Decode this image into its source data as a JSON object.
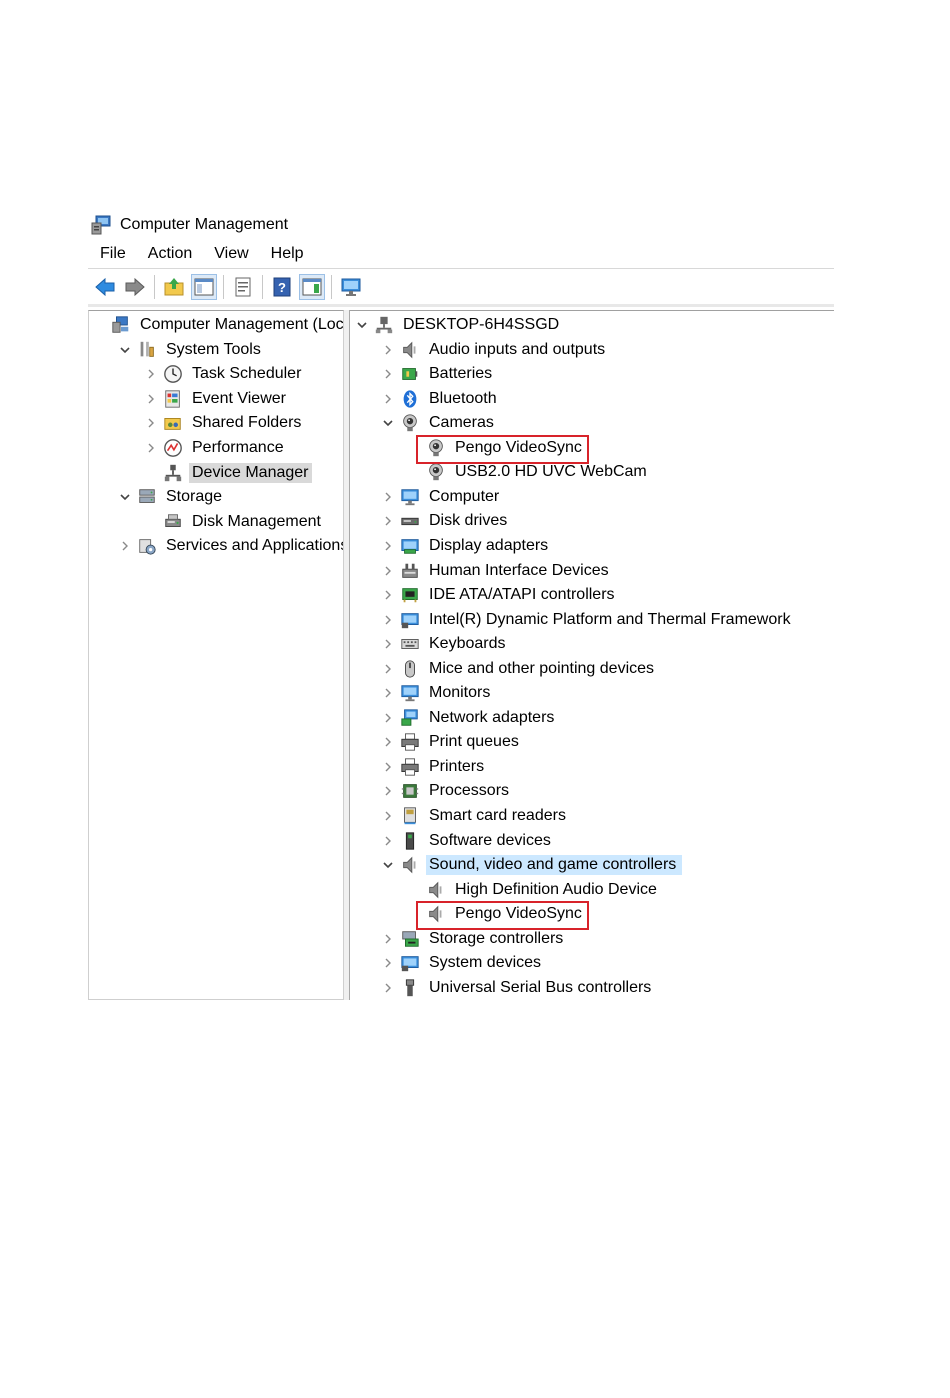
{
  "window": {
    "title": "Computer Management"
  },
  "menu": [
    "File",
    "Action",
    "View",
    "Help"
  ],
  "toolbar": [
    {
      "icon": "back-arrow-icon"
    },
    {
      "icon": "forward-arrow-icon"
    },
    {
      "sep": true
    },
    {
      "icon": "up-folder-icon"
    },
    {
      "icon": "show-hide-console-tree-icon",
      "pressed": true
    },
    {
      "sep": true
    },
    {
      "icon": "properties-icon"
    },
    {
      "sep": true
    },
    {
      "icon": "help-icon"
    },
    {
      "icon": "show-hide-action-pane-icon",
      "pressed": true
    },
    {
      "sep": true
    },
    {
      "icon": "monitor-icon"
    }
  ],
  "left_tree": [
    {
      "label": "Computer Management (Local",
      "icon": "computer-management-icon",
      "level": 0,
      "chev": "none"
    },
    {
      "label": "System Tools",
      "icon": "system-tools-icon",
      "level": 1,
      "chev": "down"
    },
    {
      "label": "Task Scheduler",
      "icon": "clock-icon",
      "level": 2,
      "chev": "right"
    },
    {
      "label": "Event Viewer",
      "icon": "event-viewer-icon",
      "level": 2,
      "chev": "right"
    },
    {
      "label": "Shared Folders",
      "icon": "shared-folders-icon",
      "level": 2,
      "chev": "right"
    },
    {
      "label": "Performance",
      "icon": "performance-icon",
      "level": 2,
      "chev": "right"
    },
    {
      "label": "Device Manager",
      "icon": "device-manager-icon",
      "level": 2,
      "chev": "none",
      "selected": true
    },
    {
      "label": "Storage",
      "icon": "storage-icon",
      "level": 1,
      "chev": "down"
    },
    {
      "label": "Disk Management",
      "icon": "disk-management-icon",
      "level": 2,
      "chev": "none"
    },
    {
      "label": "Services and Applications",
      "icon": "services-icon",
      "level": 1,
      "chev": "right"
    }
  ],
  "right_tree": [
    {
      "label": "DESKTOP-6H4SSGD",
      "icon": "computer-root-icon",
      "level": 0,
      "chev": "down"
    },
    {
      "label": "Audio inputs and outputs",
      "icon": "speaker-icon",
      "level": 1,
      "chev": "right"
    },
    {
      "label": "Batteries",
      "icon": "battery-icon",
      "level": 1,
      "chev": "right"
    },
    {
      "label": "Bluetooth",
      "icon": "bluetooth-icon",
      "level": 1,
      "chev": "right"
    },
    {
      "label": "Cameras",
      "icon": "webcam-icon",
      "level": 1,
      "chev": "down"
    },
    {
      "label": "Pengo VideoSync",
      "icon": "webcam-icon",
      "level": 2,
      "chev": "none",
      "highlight": true
    },
    {
      "label": "USB2.0 HD UVC WebCam",
      "icon": "webcam-icon",
      "level": 2,
      "chev": "none"
    },
    {
      "label": "Computer",
      "icon": "monitor-icon",
      "level": 1,
      "chev": "right"
    },
    {
      "label": "Disk drives",
      "icon": "disk-drive-icon",
      "level": 1,
      "chev": "right"
    },
    {
      "label": "Display adapters",
      "icon": "display-adapter-icon",
      "level": 1,
      "chev": "right"
    },
    {
      "label": "Human Interface Devices",
      "icon": "hid-icon",
      "level": 1,
      "chev": "right"
    },
    {
      "label": "IDE ATA/ATAPI controllers",
      "icon": "ide-controller-icon",
      "level": 1,
      "chev": "right"
    },
    {
      "label": "Intel(R) Dynamic Platform and Thermal Framework",
      "icon": "system-device-icon",
      "level": 1,
      "chev": "right"
    },
    {
      "label": "Keyboards",
      "icon": "keyboard-icon",
      "level": 1,
      "chev": "right"
    },
    {
      "label": "Mice and other pointing devices",
      "icon": "mouse-icon",
      "level": 1,
      "chev": "right"
    },
    {
      "label": "Monitors",
      "icon": "monitor-icon",
      "level": 1,
      "chev": "right"
    },
    {
      "label": "Network adapters",
      "icon": "network-adapter-icon",
      "level": 1,
      "chev": "right"
    },
    {
      "label": "Print queues",
      "icon": "printer-icon",
      "level": 1,
      "chev": "right"
    },
    {
      "label": "Printers",
      "icon": "printer-icon",
      "level": 1,
      "chev": "right"
    },
    {
      "label": "Processors",
      "icon": "processor-icon",
      "level": 1,
      "chev": "right"
    },
    {
      "label": "Smart card readers",
      "icon": "smart-card-icon",
      "level": 1,
      "chev": "right"
    },
    {
      "label": "Software devices",
      "icon": "software-device-icon",
      "level": 1,
      "chev": "right"
    },
    {
      "label": "Sound, video and game controllers",
      "icon": "speaker-icon",
      "level": 1,
      "chev": "down",
      "selected": true
    },
    {
      "label": "High Definition Audio Device",
      "icon": "speaker-icon",
      "level": 2,
      "chev": "none"
    },
    {
      "label": "Pengo VideoSync",
      "icon": "speaker-icon",
      "level": 2,
      "chev": "none",
      "highlight": true
    },
    {
      "label": "Storage controllers",
      "icon": "storage-controller-icon",
      "level": 1,
      "chev": "right"
    },
    {
      "label": "System devices",
      "icon": "system-device-icon",
      "level": 1,
      "chev": "right"
    },
    {
      "label": "Universal Serial Bus controllers",
      "icon": "usb-icon",
      "level": 1,
      "chev": "right"
    }
  ],
  "colors": {
    "highlight_box": "#d8232a",
    "selection_blue": "#cce8ff",
    "selection_gray": "#d9d9d9"
  }
}
